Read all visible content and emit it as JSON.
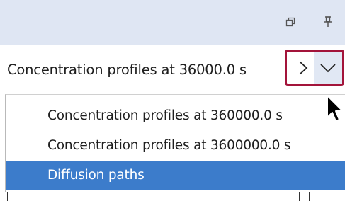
{
  "combo": {
    "selected": "Concentration profiles at 36000.0 s"
  },
  "dropdown": {
    "items": [
      {
        "label": "Concentration profiles at 360000.0 s",
        "selected": false
      },
      {
        "label": "Concentration profiles at 3600000.0 s",
        "selected": false
      },
      {
        "label": "Diffusion paths",
        "selected": true
      }
    ]
  },
  "icons": {
    "restore": "restore-window-icon",
    "pin": "pin-icon",
    "next": "chevron-right-icon",
    "dropdown": "chevron-down-icon",
    "cursor": "mouse-pointer-icon"
  },
  "colors": {
    "title_bar": "#dfe6f3",
    "highlight_border": "#a3143a",
    "selected_item": "#3c7ccb",
    "dropdown_button": "#e1e8f4"
  }
}
